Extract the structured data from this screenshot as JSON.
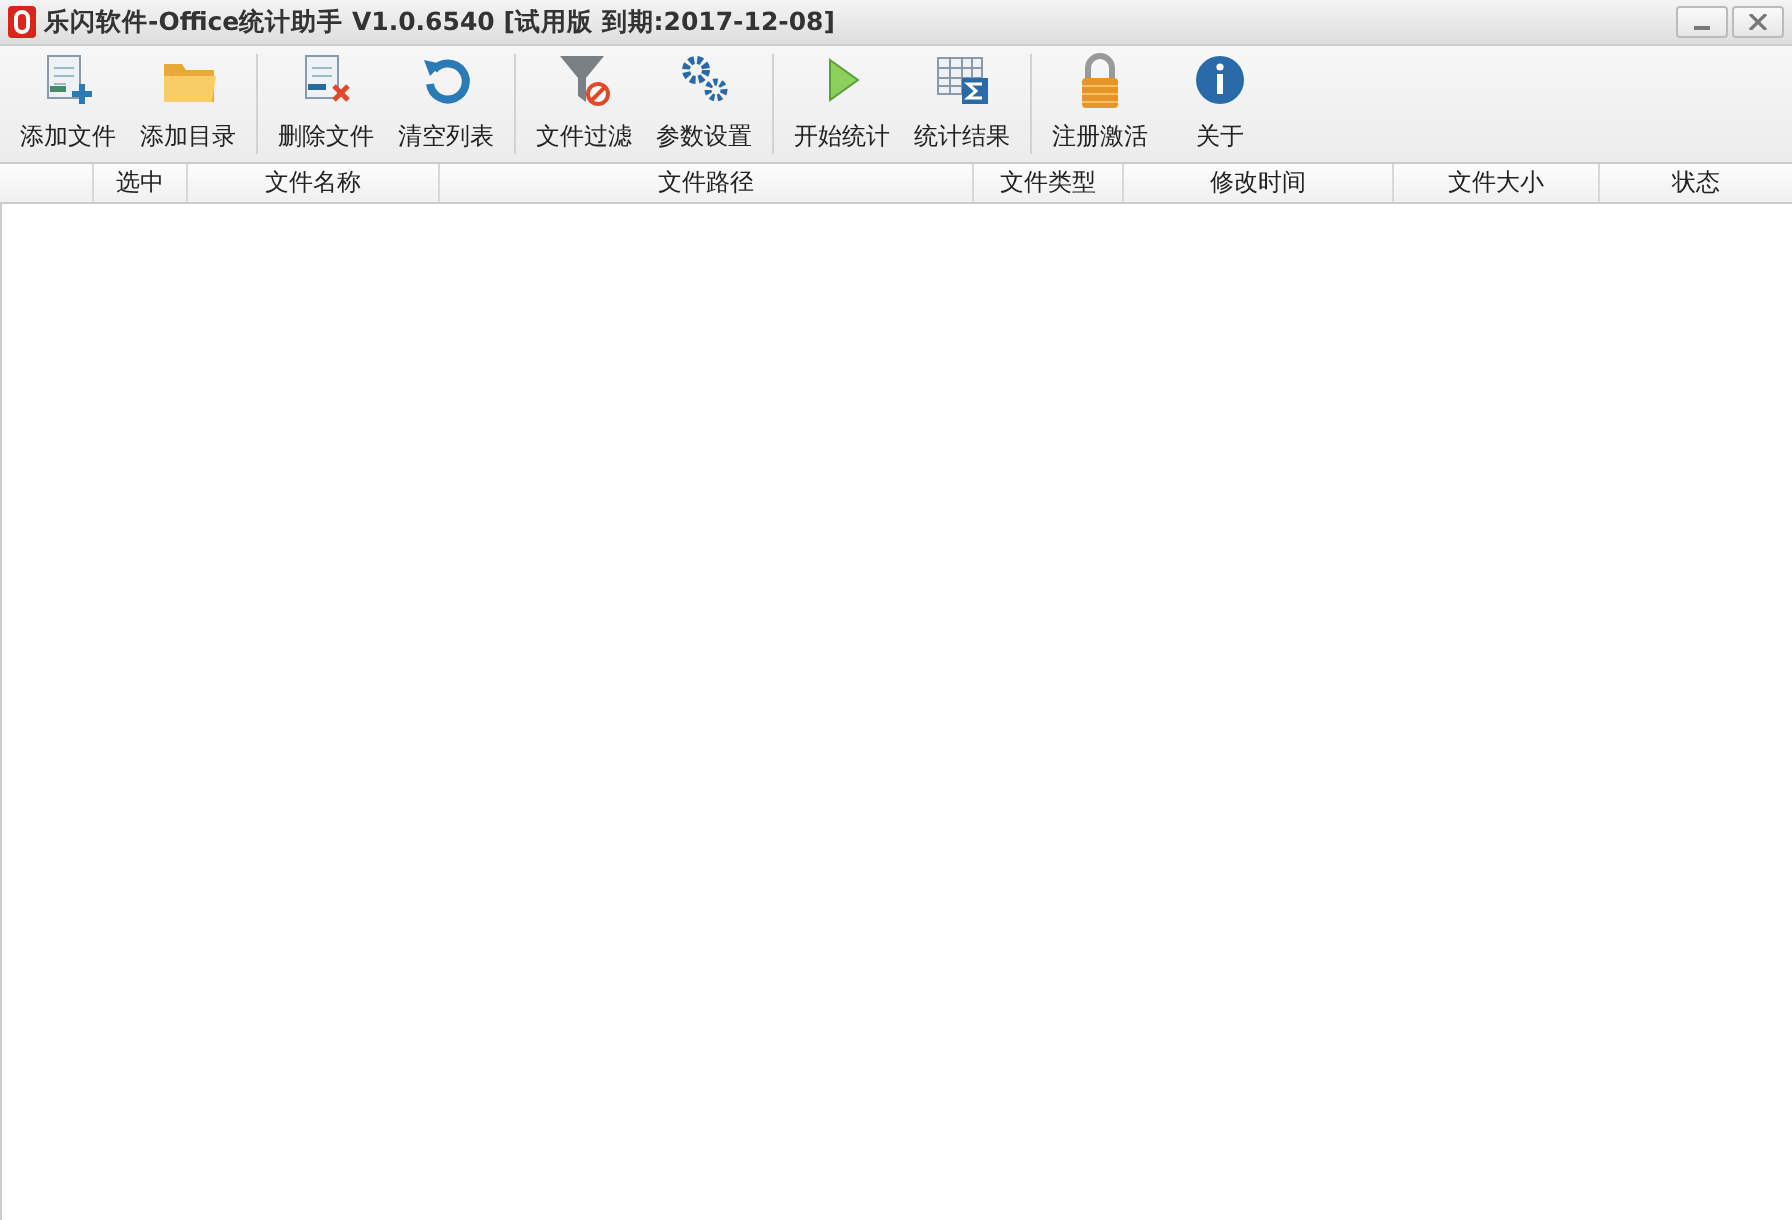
{
  "window": {
    "title": "乐闪软件-Office统计助手 V1.0.6540 [试用版 到期:2017-12-08]"
  },
  "toolbar": {
    "groups": [
      [
        {
          "label": "添加文件"
        },
        {
          "label": "添加目录"
        }
      ],
      [
        {
          "label": "删除文件"
        },
        {
          "label": "清空列表"
        }
      ],
      [
        {
          "label": "文件过滤"
        },
        {
          "label": "参数设置"
        }
      ],
      [
        {
          "label": "开始统计"
        },
        {
          "label": "统计结果"
        }
      ],
      [
        {
          "label": "注册激活"
        },
        {
          "label": "关于"
        }
      ]
    ]
  },
  "table": {
    "columns": [
      "选中",
      "文件名称",
      "文件路径",
      "文件类型",
      "修改时间",
      "文件大小",
      "状态"
    ]
  }
}
